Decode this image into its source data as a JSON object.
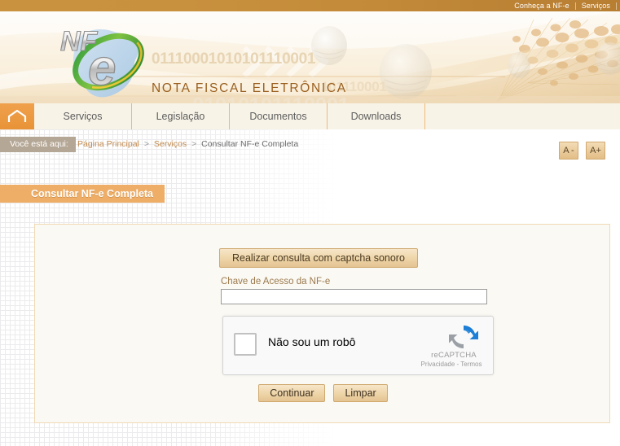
{
  "topbar": {
    "links": [
      {
        "label": "Conheça a NF-e"
      },
      {
        "label": "Serviços"
      }
    ]
  },
  "banner": {
    "logo_alt": "NF-e",
    "logo_nf": "NF",
    "logo_e": "e",
    "title": "NOTA FISCAL ELETRÔNICA",
    "binary_1": "01110001010101110001",
    "binary_2": "101110001",
    "binary_3": "01010101110001"
  },
  "menu": {
    "home_icon": "home-icon",
    "items": [
      {
        "label": "Serviços"
      },
      {
        "label": "Legislação"
      },
      {
        "label": "Documentos"
      },
      {
        "label": "Downloads"
      }
    ]
  },
  "breadcrumb": {
    "tag": "Você está aqui:",
    "items": [
      {
        "label": "Página Principal",
        "link": true
      },
      {
        "label": "Serviços",
        "link": true
      },
      {
        "label": "Consultar NF-e Completa",
        "link": false
      }
    ],
    "separator": ">"
  },
  "fontsize": {
    "decrease_label": "A -",
    "increase_label": "A+"
  },
  "page": {
    "title": "Consultar NF-e Completa"
  },
  "form": {
    "audio_captcha_button": "Realizar consulta com captcha sonoro",
    "chave_label": "Chave de Acesso da NF-e",
    "chave_value": "",
    "chave_placeholder": ""
  },
  "recaptcha": {
    "checkbox_label": "Não sou um robô",
    "brand": "reCAPTCHA",
    "terms": "Privacidade - Termos",
    "checked": false
  },
  "actions": {
    "continue_label": "Continuar",
    "clear_label": "Limpar"
  },
  "colors": {
    "topbar": "#c48c3a",
    "menu_home": "#eb9a42",
    "page_title_bg": "#eeae68",
    "breadcrumb_tag_bg": "#b5a795",
    "panel_bg": "#fbf9f3",
    "panel_border": "#f0d9b4",
    "button_border": "#cfa96f",
    "link": "#c18a4e",
    "banner_title": "#9a5f1e"
  }
}
